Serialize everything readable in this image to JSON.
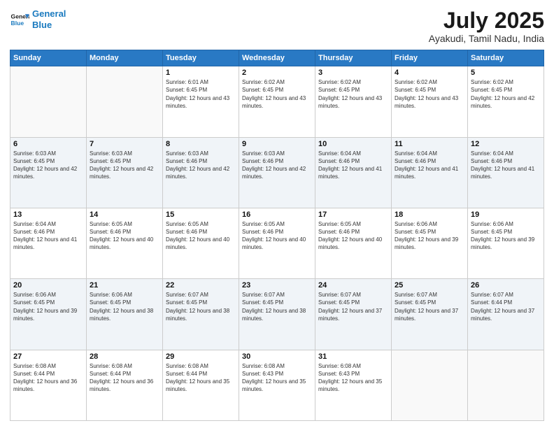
{
  "logo": {
    "line1": "General",
    "line2": "Blue"
  },
  "title": "July 2025",
  "subtitle": "Ayakudi, Tamil Nadu, India",
  "days_header": [
    "Sunday",
    "Monday",
    "Tuesday",
    "Wednesday",
    "Thursday",
    "Friday",
    "Saturday"
  ],
  "weeks": [
    [
      {
        "day": "",
        "sunrise": "",
        "sunset": "",
        "daylight": "",
        "empty": true
      },
      {
        "day": "",
        "sunrise": "",
        "sunset": "",
        "daylight": "",
        "empty": true
      },
      {
        "day": "1",
        "sunrise": "Sunrise: 6:01 AM",
        "sunset": "Sunset: 6:45 PM",
        "daylight": "Daylight: 12 hours and 43 minutes."
      },
      {
        "day": "2",
        "sunrise": "Sunrise: 6:02 AM",
        "sunset": "Sunset: 6:45 PM",
        "daylight": "Daylight: 12 hours and 43 minutes."
      },
      {
        "day": "3",
        "sunrise": "Sunrise: 6:02 AM",
        "sunset": "Sunset: 6:45 PM",
        "daylight": "Daylight: 12 hours and 43 minutes."
      },
      {
        "day": "4",
        "sunrise": "Sunrise: 6:02 AM",
        "sunset": "Sunset: 6:45 PM",
        "daylight": "Daylight: 12 hours and 43 minutes."
      },
      {
        "day": "5",
        "sunrise": "Sunrise: 6:02 AM",
        "sunset": "Sunset: 6:45 PM",
        "daylight": "Daylight: 12 hours and 42 minutes."
      }
    ],
    [
      {
        "day": "6",
        "sunrise": "Sunrise: 6:03 AM",
        "sunset": "Sunset: 6:45 PM",
        "daylight": "Daylight: 12 hours and 42 minutes."
      },
      {
        "day": "7",
        "sunrise": "Sunrise: 6:03 AM",
        "sunset": "Sunset: 6:45 PM",
        "daylight": "Daylight: 12 hours and 42 minutes."
      },
      {
        "day": "8",
        "sunrise": "Sunrise: 6:03 AM",
        "sunset": "Sunset: 6:46 PM",
        "daylight": "Daylight: 12 hours and 42 minutes."
      },
      {
        "day": "9",
        "sunrise": "Sunrise: 6:03 AM",
        "sunset": "Sunset: 6:46 PM",
        "daylight": "Daylight: 12 hours and 42 minutes."
      },
      {
        "day": "10",
        "sunrise": "Sunrise: 6:04 AM",
        "sunset": "Sunset: 6:46 PM",
        "daylight": "Daylight: 12 hours and 41 minutes."
      },
      {
        "day": "11",
        "sunrise": "Sunrise: 6:04 AM",
        "sunset": "Sunset: 6:46 PM",
        "daylight": "Daylight: 12 hours and 41 minutes."
      },
      {
        "day": "12",
        "sunrise": "Sunrise: 6:04 AM",
        "sunset": "Sunset: 6:46 PM",
        "daylight": "Daylight: 12 hours and 41 minutes."
      }
    ],
    [
      {
        "day": "13",
        "sunrise": "Sunrise: 6:04 AM",
        "sunset": "Sunset: 6:46 PM",
        "daylight": "Daylight: 12 hours and 41 minutes."
      },
      {
        "day": "14",
        "sunrise": "Sunrise: 6:05 AM",
        "sunset": "Sunset: 6:46 PM",
        "daylight": "Daylight: 12 hours and 40 minutes."
      },
      {
        "day": "15",
        "sunrise": "Sunrise: 6:05 AM",
        "sunset": "Sunset: 6:46 PM",
        "daylight": "Daylight: 12 hours and 40 minutes."
      },
      {
        "day": "16",
        "sunrise": "Sunrise: 6:05 AM",
        "sunset": "Sunset: 6:46 PM",
        "daylight": "Daylight: 12 hours and 40 minutes."
      },
      {
        "day": "17",
        "sunrise": "Sunrise: 6:05 AM",
        "sunset": "Sunset: 6:46 PM",
        "daylight": "Daylight: 12 hours and 40 minutes."
      },
      {
        "day": "18",
        "sunrise": "Sunrise: 6:06 AM",
        "sunset": "Sunset: 6:45 PM",
        "daylight": "Daylight: 12 hours and 39 minutes."
      },
      {
        "day": "19",
        "sunrise": "Sunrise: 6:06 AM",
        "sunset": "Sunset: 6:45 PM",
        "daylight": "Daylight: 12 hours and 39 minutes."
      }
    ],
    [
      {
        "day": "20",
        "sunrise": "Sunrise: 6:06 AM",
        "sunset": "Sunset: 6:45 PM",
        "daylight": "Daylight: 12 hours and 39 minutes."
      },
      {
        "day": "21",
        "sunrise": "Sunrise: 6:06 AM",
        "sunset": "Sunset: 6:45 PM",
        "daylight": "Daylight: 12 hours and 38 minutes."
      },
      {
        "day": "22",
        "sunrise": "Sunrise: 6:07 AM",
        "sunset": "Sunset: 6:45 PM",
        "daylight": "Daylight: 12 hours and 38 minutes."
      },
      {
        "day": "23",
        "sunrise": "Sunrise: 6:07 AM",
        "sunset": "Sunset: 6:45 PM",
        "daylight": "Daylight: 12 hours and 38 minutes."
      },
      {
        "day": "24",
        "sunrise": "Sunrise: 6:07 AM",
        "sunset": "Sunset: 6:45 PM",
        "daylight": "Daylight: 12 hours and 37 minutes."
      },
      {
        "day": "25",
        "sunrise": "Sunrise: 6:07 AM",
        "sunset": "Sunset: 6:45 PM",
        "daylight": "Daylight: 12 hours and 37 minutes."
      },
      {
        "day": "26",
        "sunrise": "Sunrise: 6:07 AM",
        "sunset": "Sunset: 6:44 PM",
        "daylight": "Daylight: 12 hours and 37 minutes."
      }
    ],
    [
      {
        "day": "27",
        "sunrise": "Sunrise: 6:08 AM",
        "sunset": "Sunset: 6:44 PM",
        "daylight": "Daylight: 12 hours and 36 minutes."
      },
      {
        "day": "28",
        "sunrise": "Sunrise: 6:08 AM",
        "sunset": "Sunset: 6:44 PM",
        "daylight": "Daylight: 12 hours and 36 minutes."
      },
      {
        "day": "29",
        "sunrise": "Sunrise: 6:08 AM",
        "sunset": "Sunset: 6:44 PM",
        "daylight": "Daylight: 12 hours and 35 minutes."
      },
      {
        "day": "30",
        "sunrise": "Sunrise: 6:08 AM",
        "sunset": "Sunset: 6:43 PM",
        "daylight": "Daylight: 12 hours and 35 minutes."
      },
      {
        "day": "31",
        "sunrise": "Sunrise: 6:08 AM",
        "sunset": "Sunset: 6:43 PM",
        "daylight": "Daylight: 12 hours and 35 minutes."
      },
      {
        "day": "",
        "sunrise": "",
        "sunset": "",
        "daylight": "",
        "empty": true
      },
      {
        "day": "",
        "sunrise": "",
        "sunset": "",
        "daylight": "",
        "empty": true
      }
    ]
  ]
}
